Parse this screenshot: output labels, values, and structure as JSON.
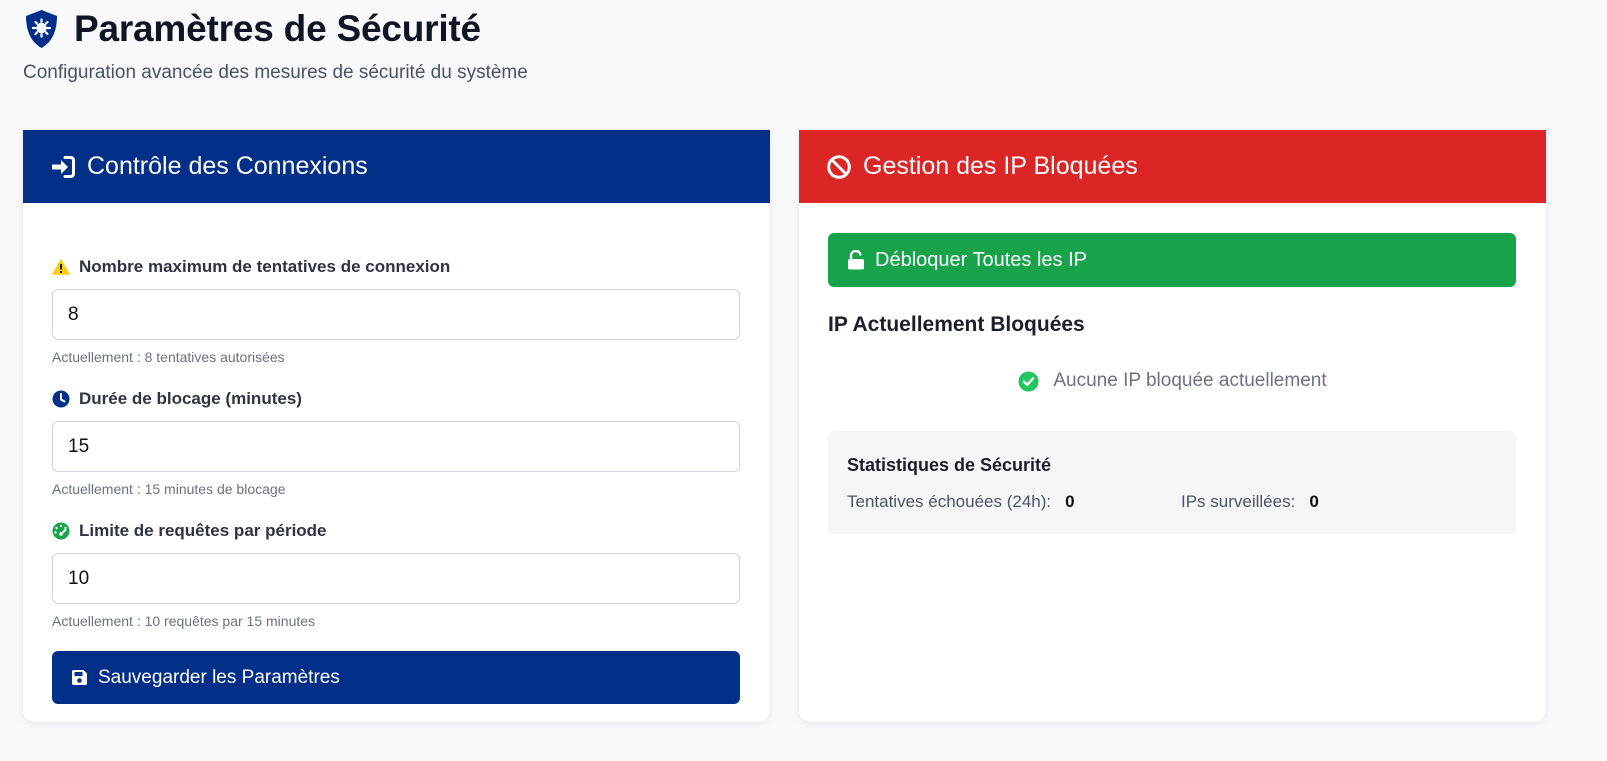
{
  "header": {
    "title": "Paramètres de Sécurité",
    "subtitle": "Configuration avancée des mesures de sécurité du système"
  },
  "colors": {
    "primary": "#022f87",
    "danger": "#dc2626",
    "success": "#16a34a",
    "warning": "#facc15"
  },
  "login_control": {
    "title": "Contrôle des Connexions",
    "icon": "sign-in-icon",
    "fields": [
      {
        "label": "Nombre maximum de tentatives de connexion",
        "icon": "warning-icon",
        "value": "8",
        "help": "Actuellement : 8 tentatives autorisées"
      },
      {
        "label": "Durée de blocage (minutes)",
        "icon": "clock-icon",
        "value": "15",
        "help": "Actuellement : 15 minutes de blocage"
      },
      {
        "label": "Limite de requêtes par période",
        "icon": "gauge-icon",
        "value": "10",
        "help": "Actuellement : 10 requêtes par 15 minutes"
      }
    ],
    "save_label": "Sauvegarder les Paramètres"
  },
  "blocked_ips": {
    "title": "Gestion des IP Bloquées",
    "icon": "ban-icon",
    "unblock_label": "Débloquer Toutes les IP",
    "list_title": "IP Actuellement Bloquées",
    "empty_message": "Aucune IP bloquée actuellement",
    "stats": {
      "title": "Statistiques de Sécurité",
      "failed_label": "Tentatives échouées (24h):",
      "failed_value": "0",
      "monitored_label": "IPs surveillées:",
      "monitored_value": "0"
    }
  }
}
